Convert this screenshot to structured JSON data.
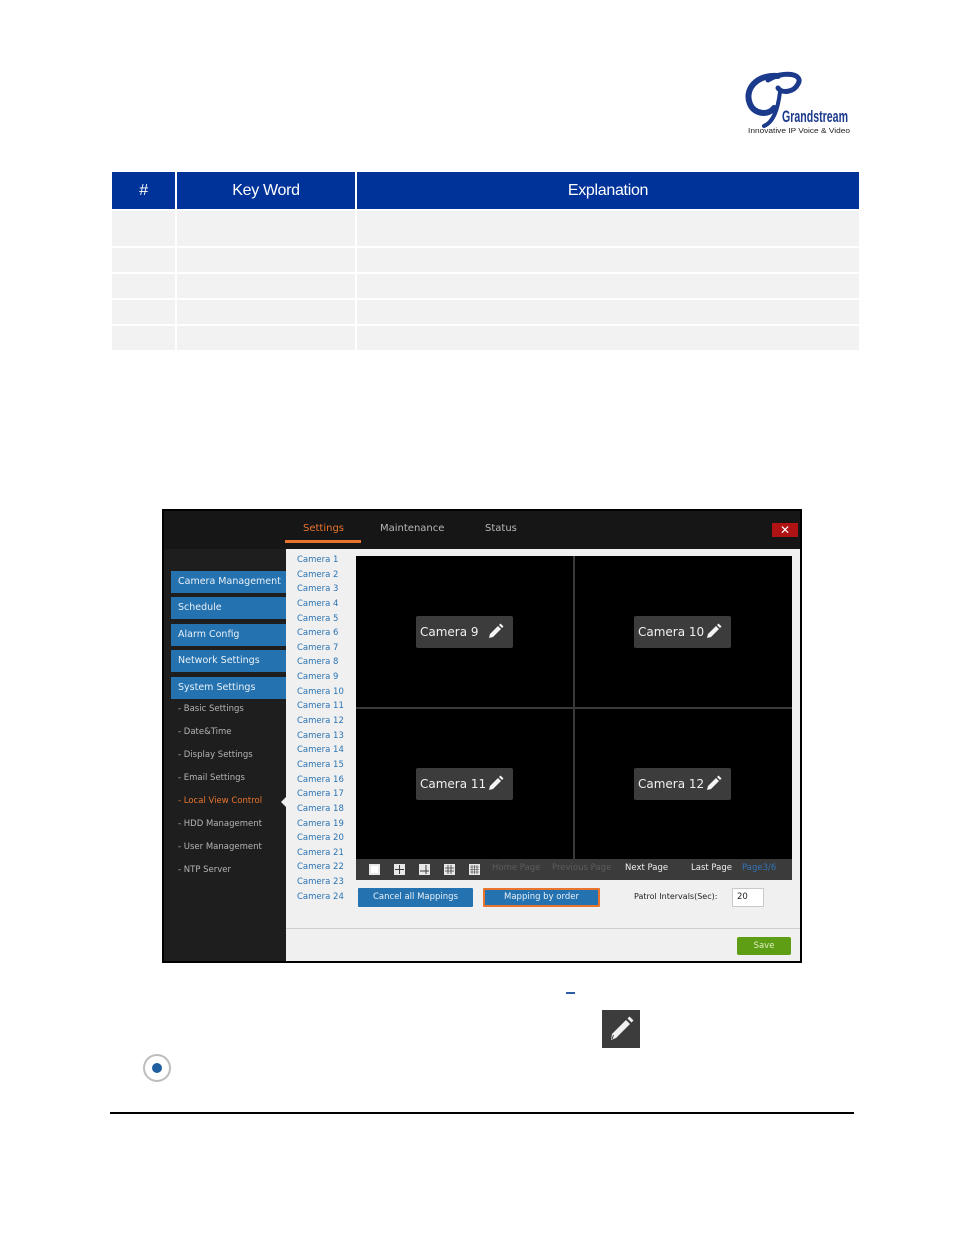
{
  "logo": {
    "brand": "Grandstream",
    "tagline": "Innovative IP Voice & Video"
  },
  "table": {
    "headers": [
      "#",
      "Key Word",
      "Explanation"
    ],
    "rows": [
      [
        "",
        "",
        ""
      ],
      [
        "",
        "",
        ""
      ],
      [
        "",
        "",
        ""
      ],
      [
        "",
        "",
        ""
      ],
      [
        "",
        "",
        ""
      ]
    ]
  },
  "app": {
    "tabs": [
      {
        "label": "Settings",
        "active": true
      },
      {
        "label": "Maintenance",
        "active": false
      },
      {
        "label": "Status",
        "active": false
      }
    ],
    "close_label": "✕",
    "sidebar": {
      "menu": [
        {
          "label": "Camera Management"
        },
        {
          "label": "Schedule"
        },
        {
          "label": "Alarm Config"
        },
        {
          "label": "Network Settings"
        },
        {
          "label": "System Settings"
        }
      ],
      "submenu": [
        {
          "label": "- Basic Settings",
          "active": false
        },
        {
          "label": "- Date&Time",
          "active": false
        },
        {
          "label": "- Display Settings",
          "active": false
        },
        {
          "label": "- Email Settings",
          "active": false
        },
        {
          "label": "- Local View Control",
          "active": true
        },
        {
          "label": "- HDD Management",
          "active": false
        },
        {
          "label": "- User Management",
          "active": false
        },
        {
          "label": "- NTP Server",
          "active": false
        }
      ]
    },
    "camera_list": [
      "Camera 1",
      "Camera 2",
      "Camera 3",
      "Camera 4",
      "Camera 5",
      "Camera 6",
      "Camera 7",
      "Camera 8",
      "Camera 9",
      "Camera 10",
      "Camera 11",
      "Camera 12",
      "Camera 13",
      "Camera 14",
      "Camera 15",
      "Camera 16",
      "Camera 17",
      "Camera 18",
      "Camera 19",
      "Camera 20",
      "Camera 21",
      "Camera 22",
      "Camera 23",
      "Camera 24"
    ],
    "grid_cells": [
      {
        "label": "Camera 9",
        "icon": "pencil-icon"
      },
      {
        "label": "Camera 10",
        "icon": "pencil-icon"
      },
      {
        "label": "Camera 11",
        "icon": "pencil-icon"
      },
      {
        "label": "Camera 12",
        "icon": "pencil-icon"
      }
    ],
    "pager": {
      "layouts": [
        "layout-1x1-icon",
        "layout-2x2-icon",
        "layout-1plus5-icon",
        "layout-3x3-icon",
        "layout-4x4-icon"
      ],
      "home_page": "Home Page",
      "previous_page": "Previous Page",
      "next_page": "Next Page",
      "last_page": "Last Page",
      "current_page": "Page3/6"
    },
    "actions": {
      "cancel_all": "Cancel all Mappings",
      "mapping_by_order": "Mapping by order",
      "patrol_label": "Patrol Intervals(Sec):",
      "patrol_value": "20",
      "save": "Save"
    },
    "colors": {
      "accent": "#e9742d",
      "primary": "#2472b0",
      "save": "#5e9e14",
      "close": "#b01313"
    }
  }
}
